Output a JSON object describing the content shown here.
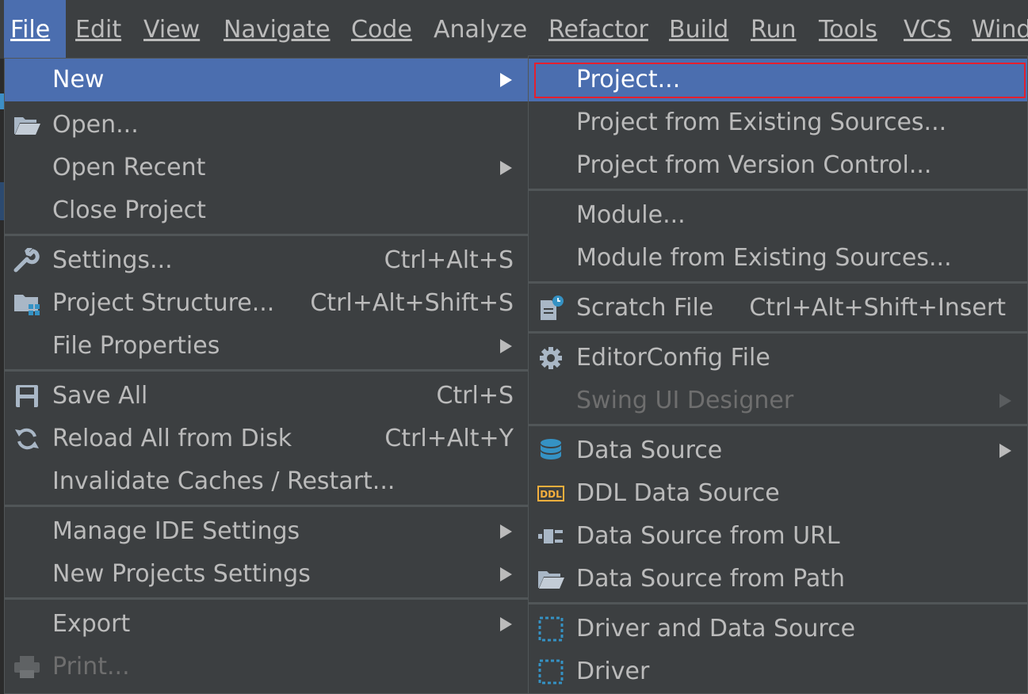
{
  "menubar": {
    "items": [
      "File",
      "Edit",
      "View",
      "Navigate",
      "Code",
      "Analyze",
      "Refactor",
      "Build",
      "Run",
      "Tools",
      "VCS",
      "Wind"
    ]
  },
  "file_menu": {
    "new": "New",
    "open": "Open...",
    "open_recent": "Open Recent",
    "close_project": "Close Project",
    "settings": "Settings...",
    "settings_shortcut": "Ctrl+Alt+S",
    "project_structure": "Project Structure...",
    "project_structure_shortcut": "Ctrl+Alt+Shift+S",
    "file_properties": "File Properties",
    "save_all": "Save All",
    "save_all_shortcut": "Ctrl+S",
    "reload_all": "Reload All from Disk",
    "reload_all_shortcut": "Ctrl+Alt+Y",
    "invalidate_caches": "Invalidate Caches / Restart...",
    "manage_ide_settings": "Manage IDE Settings",
    "new_projects_settings": "New Projects Settings",
    "export": "Export",
    "print": "Print..."
  },
  "new_menu": {
    "project": "Project...",
    "project_existing": "Project from Existing Sources...",
    "project_vcs": "Project from Version Control...",
    "module": "Module...",
    "module_existing": "Module from Existing Sources...",
    "scratch_file": "Scratch File",
    "scratch_file_shortcut": "Ctrl+Alt+Shift+Insert",
    "editorconfig": "EditorConfig File",
    "swing_ui": "Swing UI Designer",
    "data_source": "Data Source",
    "ddl_data_source": "DDL Data Source",
    "data_source_url": "Data Source from URL",
    "data_source_path": "Data Source from Path",
    "driver_and_ds": "Driver and Data Source",
    "driver": "Driver"
  },
  "colors": {
    "menu_bg": "#3c3f41",
    "highlight": "#4b6eaf",
    "separator": "#515658",
    "focus_outline": "#e5202e",
    "text": "#bbbbbb",
    "disabled_text": "#6e6e6e"
  }
}
